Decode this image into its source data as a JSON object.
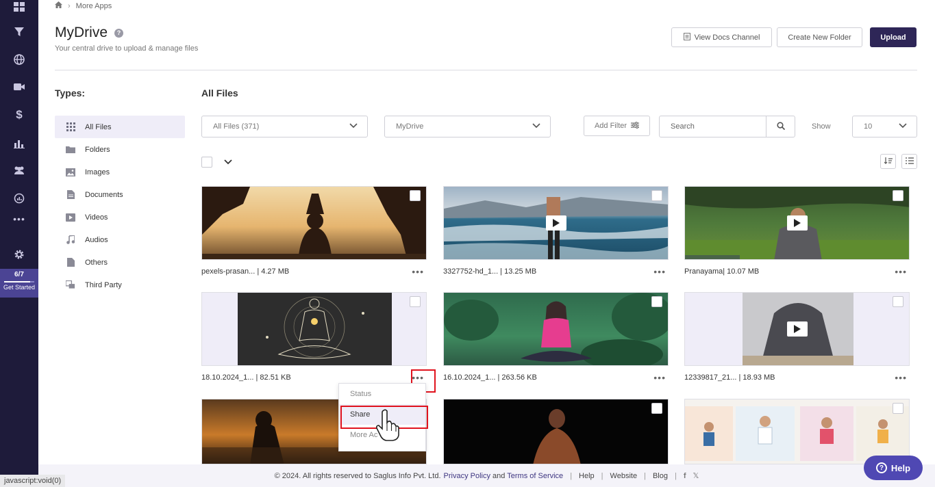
{
  "breadcrumb": {
    "current": "More Apps"
  },
  "header": {
    "title": "MyDrive",
    "subtitle": "Your central drive to upload & manage files",
    "view_docs_label": "View Docs Channel",
    "create_folder_label": "Create New Folder",
    "upload_label": "Upload"
  },
  "rail": {
    "progress_label": "6/7",
    "progress_value": 0.857,
    "get_started_label": "Get Started"
  },
  "types": {
    "title": "Types:",
    "items": [
      {
        "label": "All Files",
        "icon": "grid-icon"
      },
      {
        "label": "Folders",
        "icon": "folder-icon"
      },
      {
        "label": "Images",
        "icon": "image-icon"
      },
      {
        "label": "Documents",
        "icon": "document-icon"
      },
      {
        "label": "Videos",
        "icon": "video-icon"
      },
      {
        "label": "Audios",
        "icon": "music-icon"
      },
      {
        "label": "Others",
        "icon": "file-icon"
      },
      {
        "label": "Third Party",
        "icon": "third-party-icon"
      }
    ]
  },
  "files": {
    "title": "All Files",
    "type_select": "All Files (371)",
    "location_select": "MyDrive",
    "add_filter_label": "Add Filter",
    "search_placeholder": "Search",
    "show_label": "Show",
    "show_value": "10",
    "cards": [
      {
        "name": "pexels-prasan... | 4.27 MB",
        "video": false
      },
      {
        "name": "3327752-hd_1... | 13.25 MB",
        "video": true
      },
      {
        "name": "Pranayama| 10.07 MB",
        "video": true
      },
      {
        "name": "18.10.2024_1... | 82.51 KB",
        "video": false
      },
      {
        "name": "16.10.2024_1... | 263.56 KB",
        "video": false
      },
      {
        "name": "12339817_21... | 18.93 MB",
        "video": true
      },
      {
        "name": "",
        "video": false
      },
      {
        "name": "",
        "video": false
      },
      {
        "name": "",
        "video": false
      }
    ]
  },
  "menu": {
    "status_label": "Status",
    "share_label": "Share",
    "more_label": "More Ac"
  },
  "footer": {
    "copyright": "© 2024. All rights reserved to Saglus Info Pvt. Ltd.",
    "privacy": "Privacy Policy",
    "and": "and",
    "terms": "Terms of Service",
    "help": "Help",
    "website": "Website",
    "blog": "Blog"
  },
  "status_bar": "javascript:void(0)",
  "help_fab_label": "Help",
  "colors": {
    "accent": "#2e2657",
    "rail": "#1e1b3a",
    "highlight": "#e0121d",
    "selected_bg": "#efedf8"
  }
}
